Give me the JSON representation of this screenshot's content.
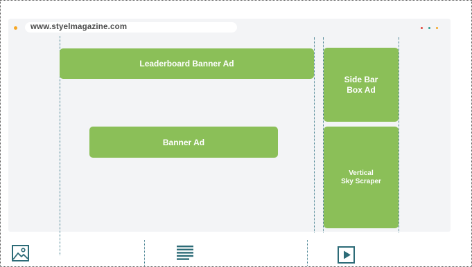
{
  "browser": {
    "url": "www.styelmagazine.com"
  },
  "colors": {
    "ad_green": "#8bbf58",
    "browser_bg": "#f3f4f6",
    "guide_line": "#3b7a8a",
    "icon": "#2c6b77",
    "window_dots": [
      "#e0453a",
      "#2a9d8f",
      "#f5a623"
    ]
  },
  "ads": {
    "leaderboard": "Leaderboard Banner Ad",
    "sidebar_box": "Side Bar\nBox Ad",
    "banner": "Banner Ad",
    "skyscraper": "Vertical\nSky Scraper"
  },
  "bottom_icons": [
    "image-icon",
    "text-lines-icon",
    "video-play-icon"
  ]
}
